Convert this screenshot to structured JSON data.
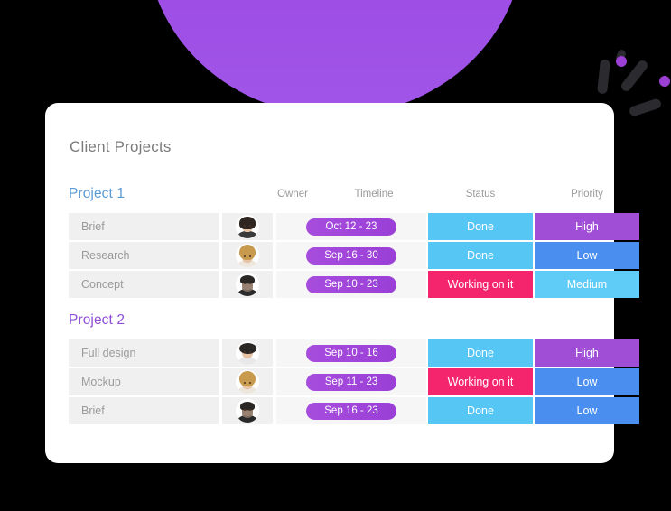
{
  "card": {
    "title": "Client Projects"
  },
  "columns": {
    "owner": "Owner",
    "timeline": "Timeline",
    "status": "Status",
    "priority": "Priority"
  },
  "colors": {
    "project1_accent": "#5b9bd5",
    "project2_accent": "#8f4fd8",
    "pill_purple": "#9a3fd6",
    "status_done": "#56c7f5",
    "status_working": "#f4256d",
    "priority_high": "#a04ed6",
    "priority_low": "#4a8ef0",
    "priority_medium": "#5fcbf7",
    "dome_purple": "#9b3fe0",
    "deco_dot": "#9c3fd4",
    "deco_bar": "#2b2b2f"
  },
  "groups": [
    {
      "name": "Project 1",
      "accent": "blue",
      "rows": [
        {
          "task": "Brief",
          "owner_icon": "avatar-dark-haired-woman",
          "owner_variant": "av-darkhair",
          "timeline": "Oct 12 - 23",
          "status": "Done",
          "status_color": "c-cyan",
          "priority": "High",
          "priority_color": "c-purple"
        },
        {
          "task": "Research",
          "owner_icon": "avatar-blonde-woman",
          "owner_variant": "av-blonde",
          "timeline": "Sep 16 - 30",
          "status": "Done",
          "status_color": "c-cyan",
          "priority": "Low",
          "priority_color": "c-blue"
        },
        {
          "task": "Concept",
          "owner_icon": "avatar-bearded-man",
          "owner_variant": "av-beardman",
          "timeline": "Sep 10 - 23",
          "status": "Working on it",
          "status_color": "c-pink",
          "priority": "Medium",
          "priority_color": "c-skyblue"
        }
      ]
    },
    {
      "name": "Project 2",
      "accent": "purple",
      "rows": [
        {
          "task": "Full design",
          "owner_icon": "avatar-curly-haired-person",
          "owner_variant": "av-curly",
          "timeline": "Sep 10 - 16",
          "status": "Done",
          "status_color": "c-cyan",
          "priority": "High",
          "priority_color": "c-purple"
        },
        {
          "task": "Mockup",
          "owner_icon": "avatar-blonde-woman",
          "owner_variant": "av-blonde",
          "timeline": "Sep 11 - 23",
          "status": "Working on it",
          "status_color": "c-pink",
          "priority": "Low",
          "priority_color": "c-blue"
        },
        {
          "task": "Brief",
          "owner_icon": "avatar-bearded-man",
          "owner_variant": "av-beardman",
          "timeline": "Sep 16 - 23",
          "status": "Done",
          "status_color": "c-cyan",
          "priority": "Low",
          "priority_color": "c-blue"
        }
      ]
    }
  ],
  "decorations": {
    "dome": "purple-dome-shape",
    "bars": [
      "deco-bar-1",
      "deco-bar-2",
      "deco-bar-3",
      "deco-bar-4"
    ],
    "dots": [
      "deco-dot-1",
      "deco-dot-2"
    ]
  }
}
